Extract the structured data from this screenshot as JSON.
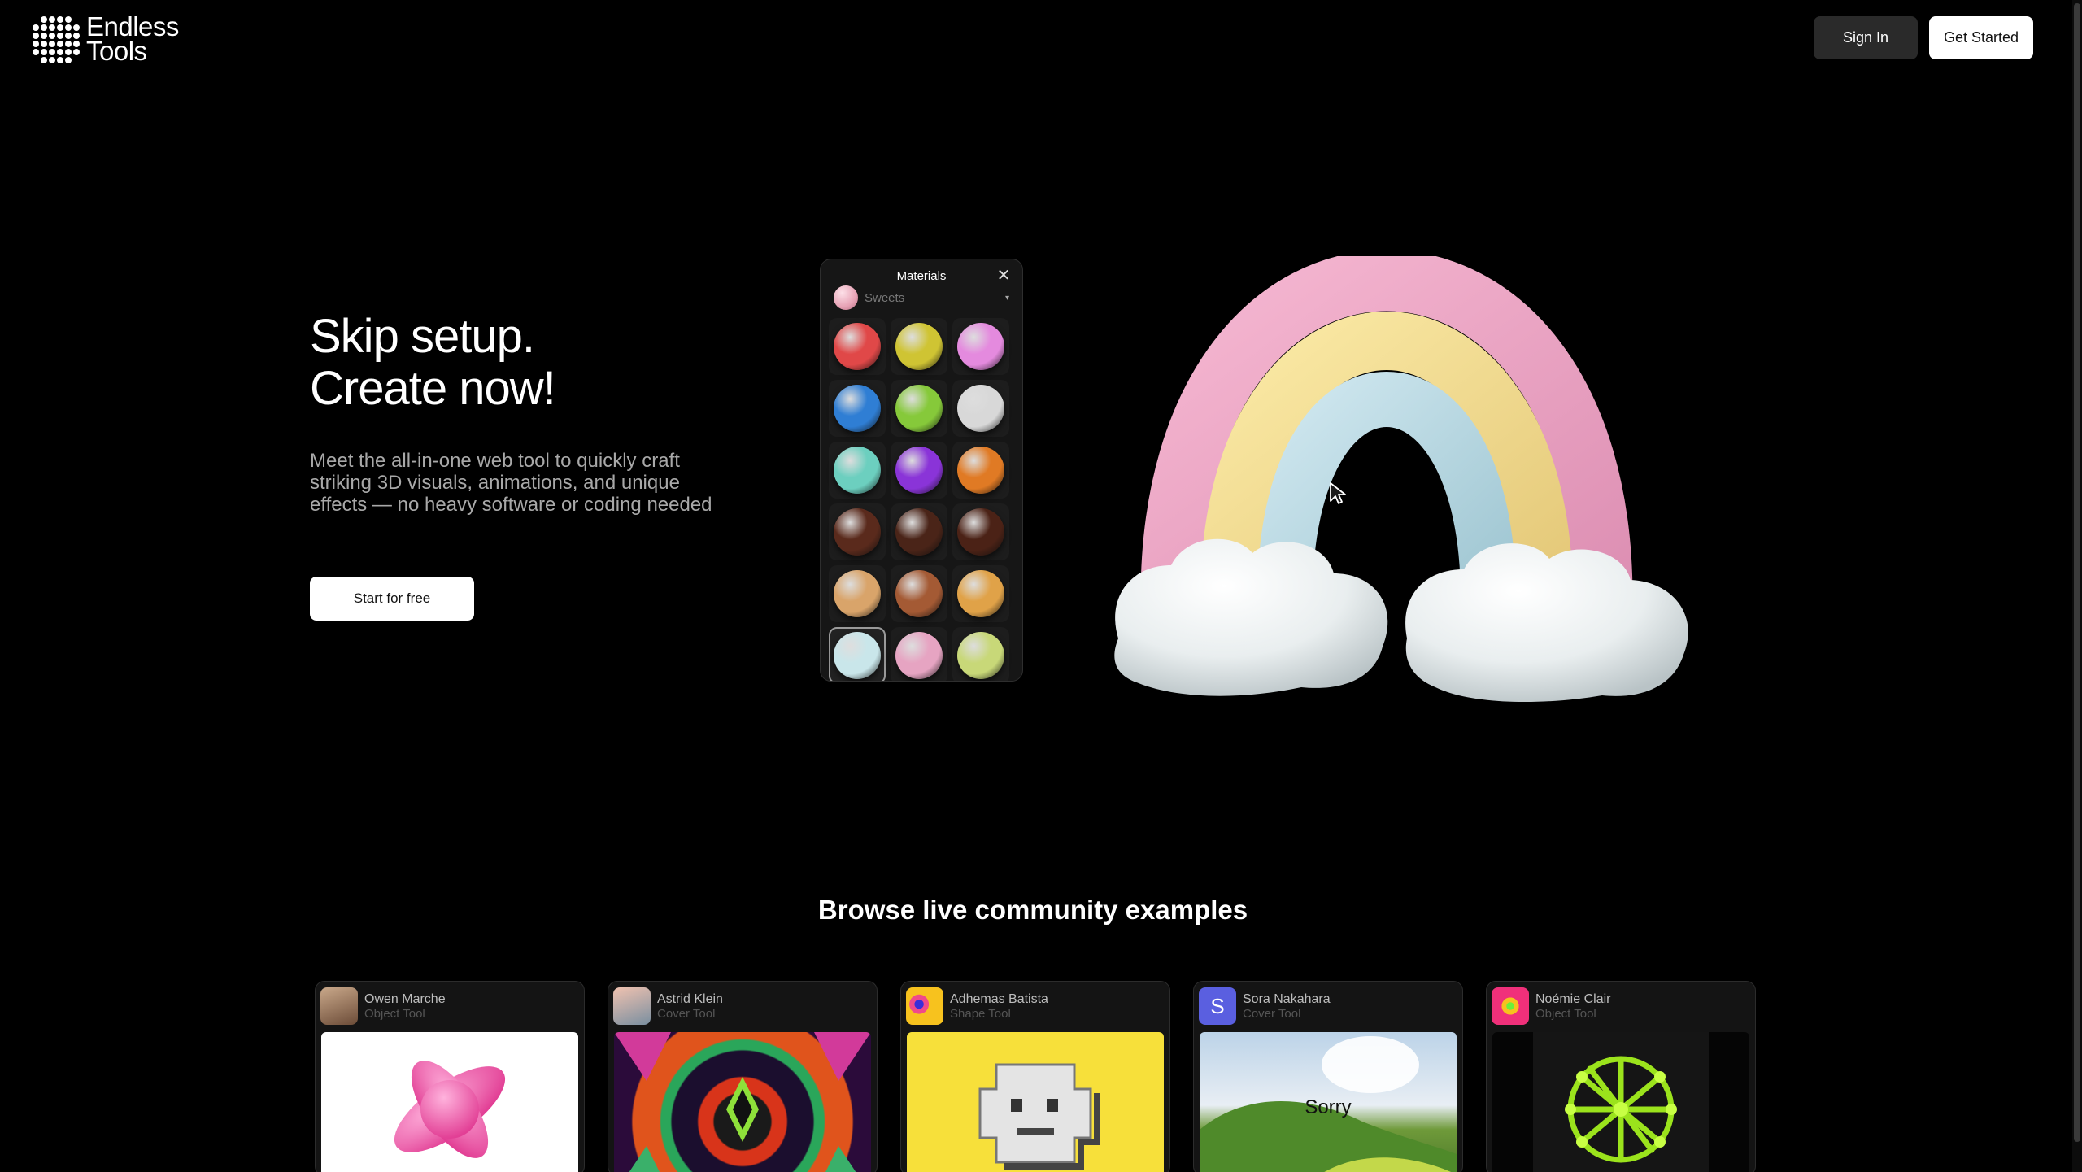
{
  "brand": {
    "name_line1": "Endless",
    "name_line2": "Tools"
  },
  "header": {
    "sign_in": "Sign In",
    "get_started": "Get Started"
  },
  "hero": {
    "title_line1": "Skip setup.",
    "title_line2": "Create now!",
    "subtitle": "Meet the all-in-one web tool to quickly craft striking 3D visuals, animations, and unique effects — no heavy software or coding needed",
    "cta": "Start for free"
  },
  "materials_panel": {
    "title": "Materials",
    "category": "Sweets",
    "swatches": [
      "#e04848",
      "#cfc433",
      "#e48ade",
      "#2f7ed4",
      "#86c93a",
      "#d8d8d8",
      "#6ccfbf",
      "#8a34d8",
      "#e07a24",
      "#5a2a1c",
      "#4a2418",
      "#4b2216",
      "#d9a46a",
      "#a45a34",
      "#e0a248",
      "#c9e6ea",
      "#e6a4c2",
      "#c8d878"
    ],
    "selected_index": 15
  },
  "community": {
    "title": "Browse live community examples",
    "cards": [
      {
        "name": "Owen Marche",
        "tool": "Object Tool",
        "avatar_letter": ""
      },
      {
        "name": "Astrid Klein",
        "tool": "Cover Tool",
        "avatar_letter": ""
      },
      {
        "name": "Adhemas Batista",
        "tool": "Shape Tool",
        "avatar_letter": ""
      },
      {
        "name": "Sora Nakahara",
        "tool": "Cover Tool",
        "avatar_letter": "S",
        "thumb_text": "Sorry"
      },
      {
        "name": "Noémie Clair",
        "tool": "Object Tool",
        "avatar_letter": ""
      }
    ]
  }
}
